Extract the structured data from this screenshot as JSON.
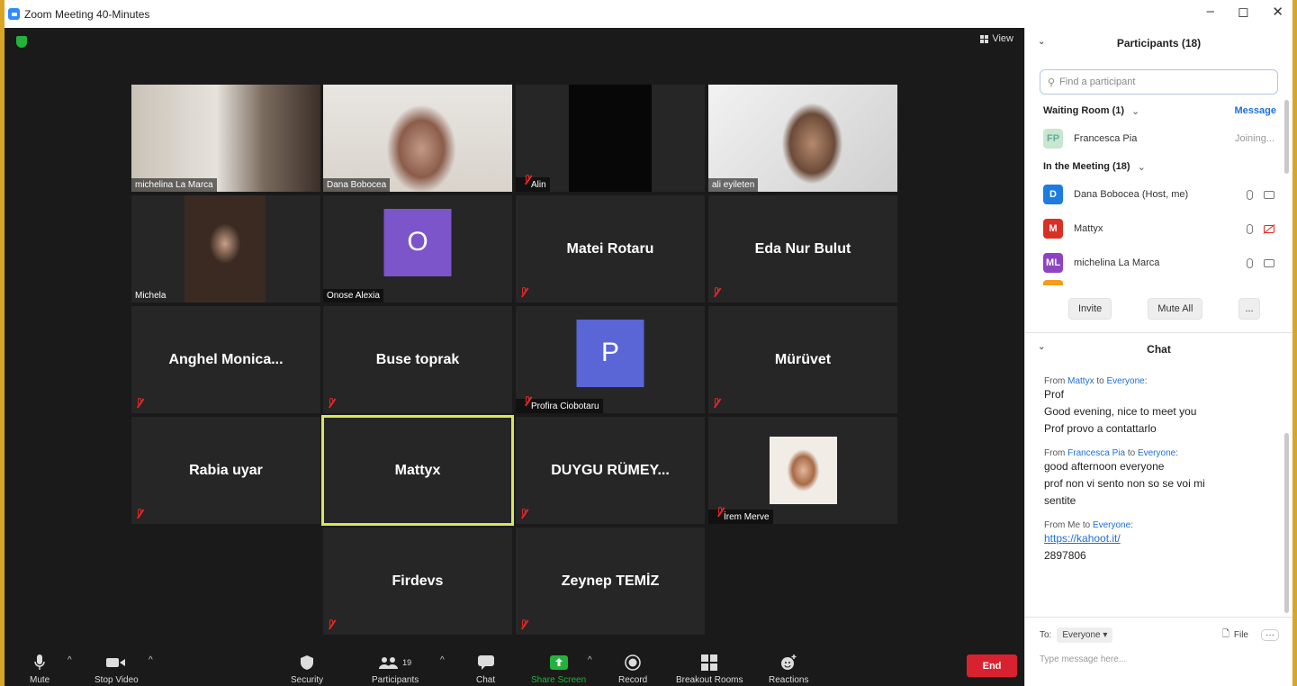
{
  "window": {
    "title": "Zoom Meeting 40-Minutes",
    "controls": [
      "–",
      "◻",
      "✕"
    ]
  },
  "meeting": {
    "view_label": "View",
    "tiles": [
      {
        "name": "michelina La Marca",
        "type": "video",
        "muted": false
      },
      {
        "name": "Dana Bobocea",
        "type": "video",
        "muted": false
      },
      {
        "name": "Alin",
        "type": "video",
        "muted": true
      },
      {
        "name": "ali eyileten",
        "type": "video",
        "muted": false
      },
      {
        "name": "Michela",
        "type": "video",
        "muted": false
      },
      {
        "name": "Onose Alexia",
        "type": "avatar",
        "letter": "O",
        "muted": false
      },
      {
        "name": "Matei Rotaru",
        "type": "name",
        "muted": true
      },
      {
        "name": "Eda Nur Bulut",
        "type": "name",
        "muted": true
      },
      {
        "name": "Anghel  Monica...",
        "type": "name",
        "muted": true
      },
      {
        "name": "Buse toprak",
        "type": "name",
        "muted": true
      },
      {
        "name": "Profira Ciobotaru",
        "type": "avatar",
        "letter": "P",
        "muted": true
      },
      {
        "name": "Mürüvet",
        "type": "name",
        "muted": true
      },
      {
        "name": "Rabia uyar",
        "type": "name",
        "muted": true
      },
      {
        "name": "Mattyx",
        "type": "name",
        "muted": false,
        "active": true
      },
      {
        "name": "DUYGU RÜMEY...",
        "type": "name",
        "muted": true
      },
      {
        "name": "İrem Merve",
        "type": "photo",
        "muted": true
      },
      {
        "name": "Firdevs",
        "type": "name",
        "muted": true
      },
      {
        "name": "Zeynep TEMİZ",
        "type": "name",
        "muted": true
      }
    ]
  },
  "toolbar": {
    "mute": "Mute",
    "stop_video": "Stop Video",
    "security": "Security",
    "participants": "Participants",
    "participants_count": "19",
    "chat": "Chat",
    "share_screen": "Share Screen",
    "record": "Record",
    "breakout_rooms": "Breakout Rooms",
    "reactions": "Reactions",
    "end": "End"
  },
  "participants_panel": {
    "title": "Participants (18)",
    "search_placeholder": "Find a participant",
    "waiting_room_label": "Waiting Room (1)",
    "message_label": "Message",
    "waiting": {
      "initials": "FP",
      "name": "Francesca Pia",
      "status": "Joining..."
    },
    "in_meeting_label": "In the Meeting (18)",
    "members": [
      {
        "initial": "D",
        "name": "Dana Bobocea (Host, me)",
        "color": "#1e7be0",
        "video_off": false
      },
      {
        "initial": "M",
        "name": "Mattyx",
        "color": "#d93025",
        "video_off": true
      },
      {
        "initial": "ML",
        "name": "michelina La Marca",
        "color": "#8e44c2",
        "video_off": false
      }
    ],
    "invite": "Invite",
    "mute_all": "Mute All",
    "more": "..."
  },
  "chat_panel": {
    "title": "Chat",
    "messages": [
      {
        "from": "Mattyx",
        "to": "Everyone",
        "lines": [
          "Prof",
          "Good evening, nice to meet you",
          "Prof provo a contattarlo"
        ]
      },
      {
        "from": "Francesca Pia",
        "to": "Everyone",
        "lines": [
          "good  afternoon everyone",
          "prof non  vi sento non so se voi mi",
          "sentite"
        ]
      },
      {
        "from": "Me",
        "to": "Everyone",
        "link": "https://kahoot.it/",
        "lines": [
          "2897806"
        ]
      }
    ],
    "from_word": "From",
    "to_word": "to",
    "to_label": "To:",
    "to_value": "Everyone",
    "file_label": "File",
    "input_placeholder": "Type message here..."
  },
  "colors": {
    "meeting_bg": "#1a1a1a",
    "tile_bg": "#262626",
    "active_speaker": "#d8e65b",
    "end_button": "#d9222f",
    "share_green": "#23b33d",
    "link_blue": "#1e6fd9",
    "avatar_purple": "#7b55c9",
    "avatar_blue": "#5a66d6"
  }
}
